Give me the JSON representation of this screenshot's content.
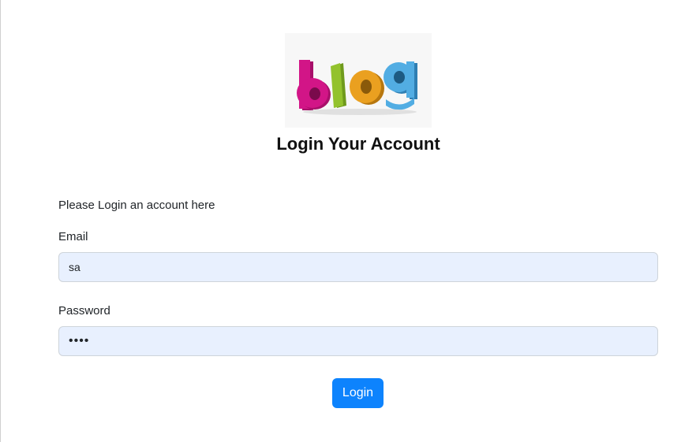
{
  "logo": {
    "text": "blog",
    "colors": [
      "#c8127f",
      "#8dbb2a",
      "#e39a1c",
      "#4aa3d8"
    ]
  },
  "form": {
    "title": "Login Your Account",
    "intro": "Please Login an account here",
    "email_label": "Email",
    "email_value": "sa",
    "password_label": "Password",
    "password_value": "••••",
    "submit_label": "Login"
  },
  "colors": {
    "accent": "#0d83fd",
    "field_bg": "#e8f0fe"
  }
}
